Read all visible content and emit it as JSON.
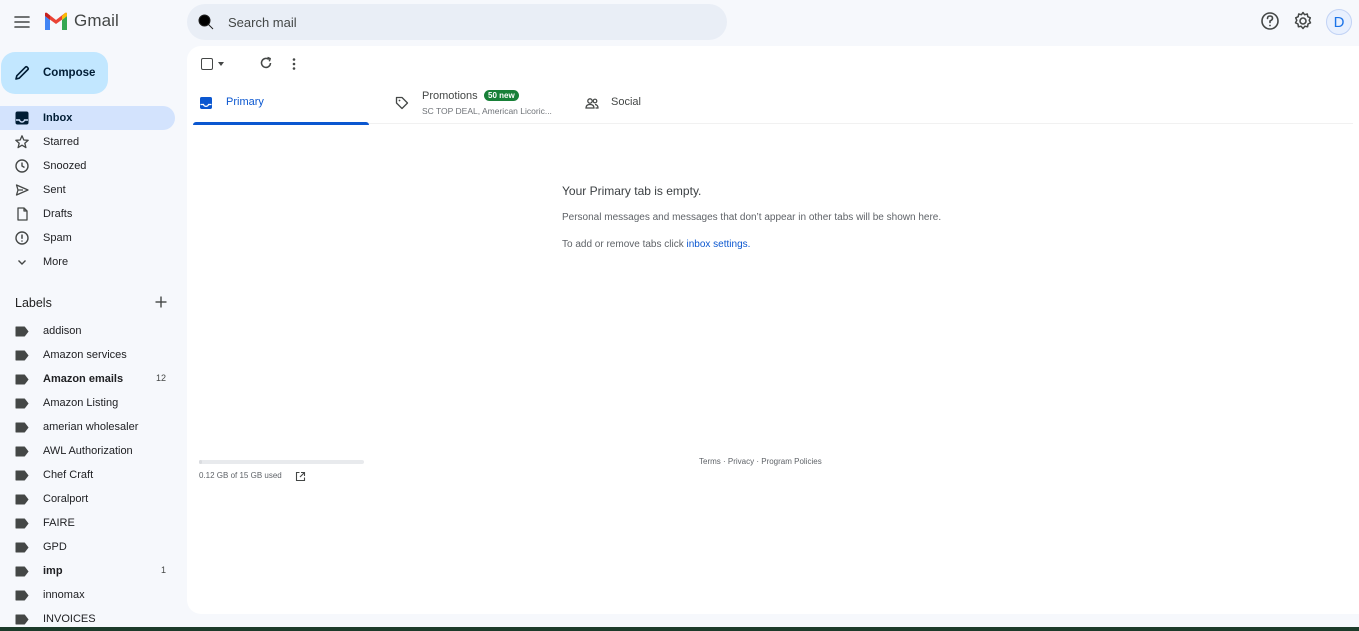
{
  "header": {
    "app_name": "Gmail",
    "search_placeholder": "Search mail",
    "avatar_letter": "D"
  },
  "sidebar": {
    "compose_label": "Compose",
    "nav": [
      {
        "label": "Inbox",
        "icon": "inbox-icon",
        "active": true
      },
      {
        "label": "Starred",
        "icon": "star-icon"
      },
      {
        "label": "Snoozed",
        "icon": "clock-icon"
      },
      {
        "label": "Sent",
        "icon": "send-icon"
      },
      {
        "label": "Drafts",
        "icon": "file-icon"
      },
      {
        "label": "Spam",
        "icon": "spam-icon"
      },
      {
        "label": "More",
        "icon": "chevron-down-icon"
      }
    ],
    "labels_title": "Labels",
    "labels": [
      {
        "label": "addison",
        "count": ""
      },
      {
        "label": "Amazon services",
        "count": ""
      },
      {
        "label": "Amazon emails",
        "count": "12",
        "bold": true
      },
      {
        "label": "Amazon Listing",
        "count": ""
      },
      {
        "label": "amerian wholesaler",
        "count": ""
      },
      {
        "label": "AWL Authorization",
        "count": ""
      },
      {
        "label": "Chef Craft",
        "count": ""
      },
      {
        "label": "Coralport",
        "count": ""
      },
      {
        "label": "FAIRE",
        "count": ""
      },
      {
        "label": "GPD",
        "count": ""
      },
      {
        "label": "imp",
        "count": "1",
        "bold": true
      },
      {
        "label": "innomax",
        "count": ""
      },
      {
        "label": "INVOICES",
        "count": ""
      }
    ]
  },
  "tabs": [
    {
      "title": "Primary",
      "active": true
    },
    {
      "title": "Promotions",
      "badge": "50 new",
      "subtitle": "SC TOP DEAL, American Licoric..."
    },
    {
      "title": "Social"
    }
  ],
  "empty_state": {
    "heading": "Your Primary tab is empty.",
    "line1": "Personal messages and messages that don’t appear in other tabs will be shown here.",
    "line2_prefix": "To add or remove tabs click ",
    "line2_link": "inbox settings."
  },
  "storage": {
    "text": "0.12 GB of 15 GB used",
    "fraction_used": 0.008
  },
  "footer": {
    "terms": "Terms",
    "sep": " · ",
    "privacy": "Privacy",
    "policies": "Program Policies"
  }
}
